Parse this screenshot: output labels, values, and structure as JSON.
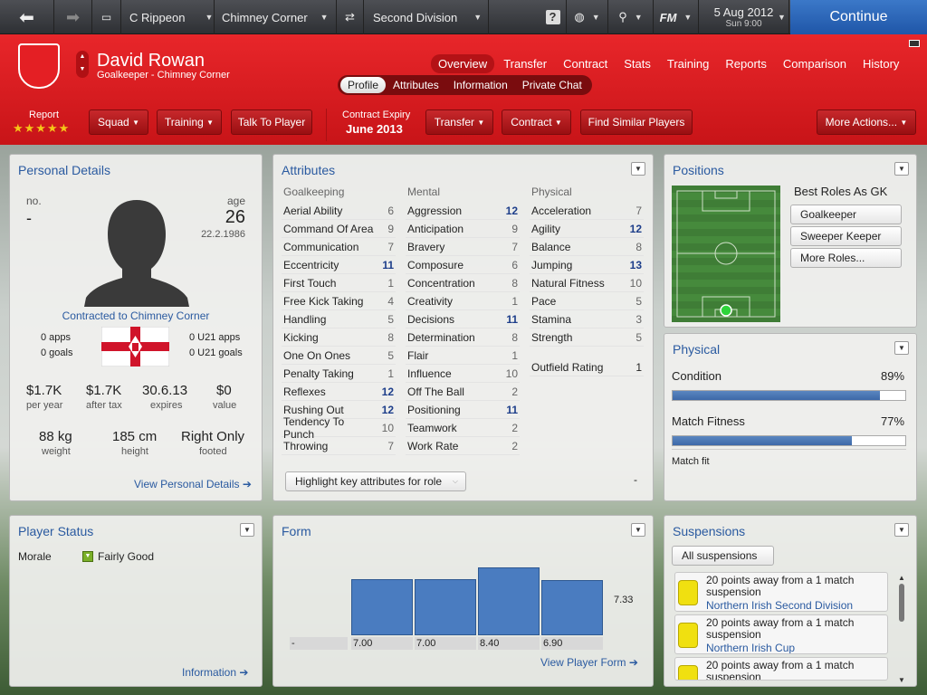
{
  "topbar": {
    "manager": "C Rippeon",
    "club": "Chimney Corner",
    "division": "Second Division",
    "fm": "FM",
    "date": "5 Aug 2012",
    "time": "Sun 9:00",
    "continue": "Continue"
  },
  "player": {
    "name": "David Rowan",
    "subtitle": "Goalkeeper - Chimney Corner"
  },
  "nav": [
    "Overview",
    "Transfer",
    "Contract",
    "Stats",
    "Training",
    "Reports",
    "Comparison",
    "History"
  ],
  "subnav": [
    "Profile",
    "Attributes",
    "Information",
    "Private Chat"
  ],
  "actions": {
    "report_label": "Report",
    "stars": "★★★★★",
    "squad": "Squad",
    "training": "Training",
    "talk": "Talk To Player",
    "contract_expiry_label": "Contract Expiry",
    "contract_expiry": "June 2013",
    "transfer": "Transfer",
    "contract": "Contract",
    "similar": "Find Similar Players",
    "more": "More Actions..."
  },
  "personal": {
    "title": "Personal Details",
    "no_label": "no.",
    "no_value": "-",
    "age_label": "age",
    "age": "26",
    "dob": "22.2.1986",
    "contracted": "Contracted to Chimney Corner",
    "apps": "0 apps",
    "goals": "0 goals",
    "u21apps": "0 U21 apps",
    "u21goals": "0 U21 goals",
    "wage1": "$1.7K",
    "wage1_l": "per year",
    "wage2": "$1.7K",
    "wage2_l": "after tax",
    "expires": "30.6.13",
    "expires_l": "expires",
    "value": "$0",
    "value_l": "value",
    "weight": "88 kg",
    "weight_l": "weight",
    "height": "185 cm",
    "height_l": "height",
    "foot": "Right Only",
    "foot_l": "footed",
    "link": "View Personal Details"
  },
  "attributes": {
    "title": "Attributes",
    "goalkeeping_h": "Goalkeeping",
    "mental_h": "Mental",
    "physical_h": "Physical",
    "goalkeeping": [
      {
        "n": "Aerial Ability",
        "v": "6"
      },
      {
        "n": "Command Of Area",
        "v": "9"
      },
      {
        "n": "Communication",
        "v": "7"
      },
      {
        "n": "Eccentricity",
        "v": "11"
      },
      {
        "n": "First Touch",
        "v": "1"
      },
      {
        "n": "Free Kick Taking",
        "v": "4"
      },
      {
        "n": "Handling",
        "v": "5"
      },
      {
        "n": "Kicking",
        "v": "8"
      },
      {
        "n": "One On Ones",
        "v": "5"
      },
      {
        "n": "Penalty Taking",
        "v": "1"
      },
      {
        "n": "Reflexes",
        "v": "12"
      },
      {
        "n": "Rushing Out",
        "v": "12"
      },
      {
        "n": "Tendency To Punch",
        "v": "10"
      },
      {
        "n": "Throwing",
        "v": "7"
      }
    ],
    "mental": [
      {
        "n": "Aggression",
        "v": "12"
      },
      {
        "n": "Anticipation",
        "v": "9"
      },
      {
        "n": "Bravery",
        "v": "7"
      },
      {
        "n": "Composure",
        "v": "6"
      },
      {
        "n": "Concentration",
        "v": "8"
      },
      {
        "n": "Creativity",
        "v": "1"
      },
      {
        "n": "Decisions",
        "v": "11"
      },
      {
        "n": "Determination",
        "v": "8"
      },
      {
        "n": "Flair",
        "v": "1"
      },
      {
        "n": "Influence",
        "v": "10"
      },
      {
        "n": "Off The Ball",
        "v": "2"
      },
      {
        "n": "Positioning",
        "v": "11"
      },
      {
        "n": "Teamwork",
        "v": "2"
      },
      {
        "n": "Work Rate",
        "v": "2"
      }
    ],
    "physical": [
      {
        "n": "Acceleration",
        "v": "7"
      },
      {
        "n": "Agility",
        "v": "12"
      },
      {
        "n": "Balance",
        "v": "8"
      },
      {
        "n": "Jumping",
        "v": "13"
      },
      {
        "n": "Natural Fitness",
        "v": "10"
      },
      {
        "n": "Pace",
        "v": "5"
      },
      {
        "n": "Stamina",
        "v": "3"
      },
      {
        "n": "Strength",
        "v": "5"
      }
    ],
    "outfield_label": "Outfield Rating",
    "outfield": "1",
    "highlight": "Highlight key attributes for role",
    "dash": "-"
  },
  "positions": {
    "title": "Positions",
    "best_roles": "Best Roles As GK",
    "roles": [
      "Goalkeeper",
      "Sweeper Keeper",
      "More Roles..."
    ]
  },
  "physical": {
    "title": "Physical",
    "condition_label": "Condition",
    "condition": "89%",
    "condition_frac": 0.89,
    "fitness_label": "Match Fitness",
    "fitness": "77%",
    "fitness_frac": 0.77,
    "status": "Match fit"
  },
  "status": {
    "title": "Player Status",
    "morale_label": "Morale",
    "morale": "Fairly Good",
    "link": "Information"
  },
  "form": {
    "title": "Form",
    "average": "7.33",
    "link": "View Player Form"
  },
  "chart_data": {
    "type": "bar",
    "categories": [
      "-",
      "7.00",
      "7.00",
      "8.40",
      "6.90"
    ],
    "values": [
      0,
      7.0,
      7.0,
      8.4,
      6.9
    ],
    "ylim": [
      0,
      9
    ]
  },
  "suspensions": {
    "title": "Suspensions",
    "filter": "All suspensions",
    "items": [
      {
        "text": "20 points away from a 1 match suspension",
        "comp": "Northern Irish Second Division"
      },
      {
        "text": "20 points away from a 1 match suspension",
        "comp": "Northern Irish Cup"
      },
      {
        "text": "20 points away from a 1 match suspension",
        "comp": ""
      }
    ]
  }
}
